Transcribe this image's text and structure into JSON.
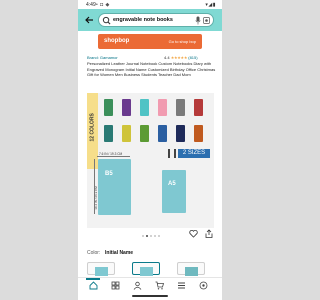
{
  "status_bar": {
    "time": "4:49",
    "right_icons": "▾◢▮"
  },
  "search": {
    "query": "engravable note books"
  },
  "banner": {
    "brand": "shopbop",
    "tagline": "Go to shop bop",
    "color": "#eb6a35"
  },
  "product": {
    "store": "Brand: Gamamor",
    "rating_value": "4.4",
    "stars": "★★★★★",
    "rating_count": "(815)",
    "title": "Personalized Leather Journal Notebook Custom Notebooks Diary with Engraved Monogram Initial Name Customized Birthday Office Christmas Gift for Women Men Business Students Teacher Dad Mom"
  },
  "image": {
    "colors_label": "12 COLORS",
    "sizes_label": "2 SIZES",
    "b5_label": "B5",
    "a5_label": "A5",
    "width_dim": "7.6 IN / 19.3 CM",
    "height_dim": "10.4 IN / 26.3 CM",
    "swatches": [
      "#3b8f5a",
      "#6a3a8e",
      "#4fc3c5",
      "#f19bb0",
      "#7a7a7a",
      "#b53a3a",
      "#2a7a74",
      "#cfc43a",
      "#5c9b34",
      "#2b5fa1",
      "#1f2b5a",
      "#c05a1f"
    ]
  },
  "carousel": {
    "count": 5,
    "active": 1
  },
  "color_selection": {
    "label": "Color:",
    "value": "Initial Name"
  },
  "nav": {
    "items": [
      "home-icon",
      "library-icon",
      "profile-icon",
      "cart-icon",
      "menu-icon",
      "assistant-icon"
    ]
  },
  "accent_color": "#80d9d3"
}
